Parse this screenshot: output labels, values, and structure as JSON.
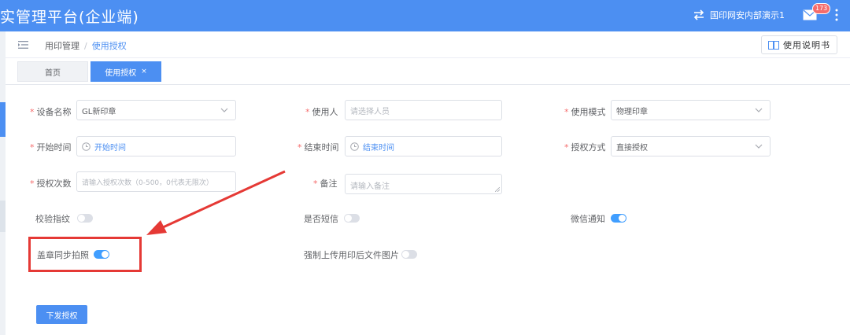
{
  "header": {
    "title": "实管理平台(企业端)",
    "org": "国印网安内部演示1",
    "mail_badge": "173",
    "brand_color": "#4c8ff2"
  },
  "breadcrumb": {
    "items": [
      "用印管理",
      "使用授权"
    ],
    "separator": "/"
  },
  "manual_button": "使用说明书",
  "tabs": [
    {
      "label": "首页",
      "active": false
    },
    {
      "label": "使用授权",
      "active": true,
      "close": "×"
    }
  ],
  "form": {
    "device": {
      "label": "设备名称",
      "value": "GL新印章"
    },
    "user": {
      "label": "使用人",
      "placeholder": "请选择人员"
    },
    "mode": {
      "label": "使用模式",
      "value": "物理印章"
    },
    "start_time": {
      "label": "开始时间",
      "placeholder": "开始时间"
    },
    "end_time": {
      "label": "结束时间",
      "placeholder": "结束时间"
    },
    "auth_method": {
      "label": "授权方式",
      "value": "直接授权"
    },
    "auth_count": {
      "label": "授权次数",
      "placeholder": "请输入授权次数（0-500，0代表无限次）"
    },
    "remark": {
      "label": "备注",
      "placeholder": "请输入备注"
    },
    "fingerprint": {
      "label": "校验指纹",
      "on": false
    },
    "sms": {
      "label": "是否短信",
      "on": false
    },
    "wechat": {
      "label": "微信通知",
      "on": true
    },
    "stamp_photo": {
      "label": "盖章同步拍照",
      "on": true
    },
    "force_upload": {
      "label": "强制上传用印后文件图片",
      "on": false
    }
  },
  "submit_button": "下发授权",
  "icons": [
    "swap-icon",
    "mail-icon",
    "more-vertical-icon",
    "menu-toggle-icon",
    "book-icon",
    "chevron-down-icon",
    "clock-icon"
  ]
}
